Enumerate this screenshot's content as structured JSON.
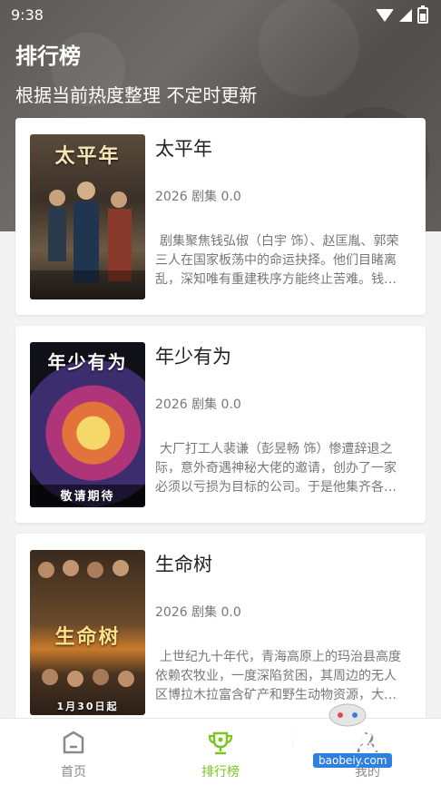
{
  "status_bar": {
    "time": "9:38"
  },
  "header": {
    "title": "排行榜",
    "subtitle": "根据当前热度整理 不定时更新"
  },
  "items": [
    {
      "title": "太平年",
      "meta": "2026 剧集 0.0",
      "description": "剧集聚焦钱弘俶（白宇 饰）、赵匡胤、郭荣三人在国家板荡中的命运抉择。他们目睹离乱，深知唯有重建秩序方能终止苦难。钱弘俶秉持“保境安民”，守…",
      "poster_text": "太平年"
    },
    {
      "title": "年少有为",
      "meta": "2026 剧集 0.0",
      "description": "大厂打工人裴谦（彭昱畅 饰）惨遭辞退之际，意外奇遇神秘大佬的邀请，创办了一家必须以亏损为目标的公司。于是他集齐各种不靠谱的虾兵蟹将，开启…",
      "poster_text": "年少有为",
      "poster_caption": "敬请期待"
    },
    {
      "title": "生命树",
      "meta": "2026 剧集 0.0",
      "description": "上世纪九十年代，青海高原上的玛治县高度依赖农牧业，一度深陷贫困，其周边的无人区博拉木拉富含矿产和野生动物资源，大量的盗猎盗采分子…年取…",
      "poster_text": "生命树",
      "poster_caption": "1月30日起"
    }
  ],
  "tabbar": {
    "tabs": [
      {
        "label": "首页",
        "icon": "home-icon",
        "active": false
      },
      {
        "label": "排行榜",
        "icon": "trophy-icon",
        "active": true
      },
      {
        "label": "我的",
        "icon": "user-icon",
        "active": false
      }
    ]
  },
  "watermark": {
    "text": "宝贝游戏网",
    "url": "baobeiy.com"
  },
  "colors": {
    "accent": "#7cc520",
    "inactive": "#8a8a8a"
  }
}
